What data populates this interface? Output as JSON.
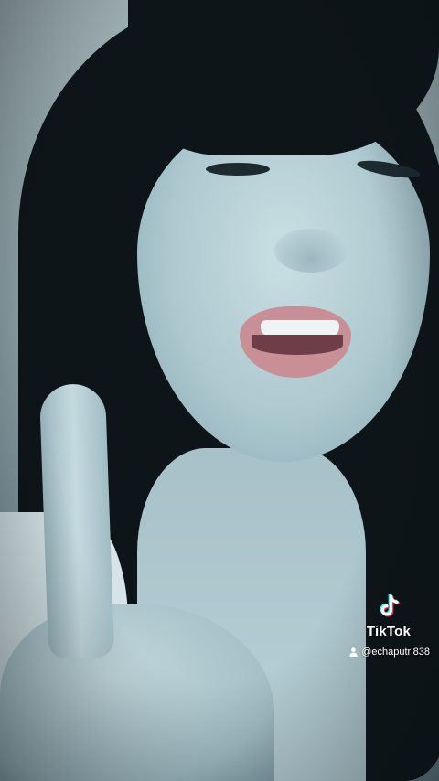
{
  "video": {
    "description_icon": "person-video-frame"
  },
  "watermark": {
    "logo_icon": "tiktok-note-icon",
    "brand": "TikTok",
    "user_icon": "user-icon",
    "handle": "@echaputri838",
    "text_color": "#ffffff",
    "logo_colors": [
      "#25f4ee",
      "#fe2c55",
      "#ffffff"
    ]
  }
}
